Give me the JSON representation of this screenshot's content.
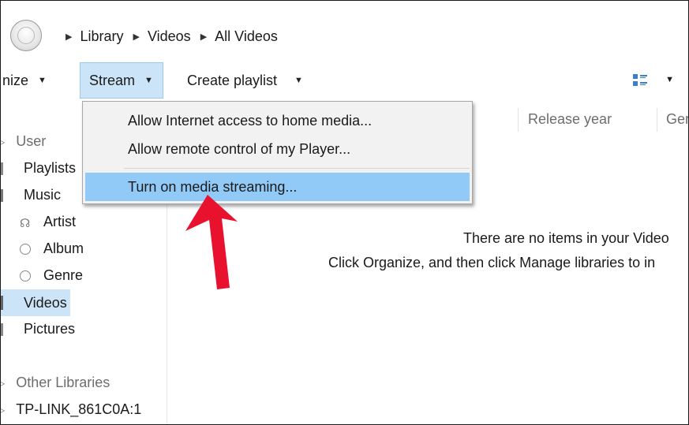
{
  "breadcrumb": [
    "Library",
    "Videos",
    "All Videos"
  ],
  "toolbar": {
    "organize_label": "nize",
    "stream_label": "Stream",
    "create_playlist_label": "Create playlist"
  },
  "stream_menu": {
    "items": [
      "Allow Internet access to home media...",
      "Allow remote control of my Player...",
      "Turn on media streaming..."
    ],
    "highlighted_index": 2
  },
  "sidebar": {
    "user": "User",
    "playlists": "Playlists",
    "music": "Music",
    "artist": "Artist",
    "album": "Album",
    "genre": "Genre",
    "videos": "Videos",
    "pictures": "Pictures",
    "other_libraries": "Other Libraries",
    "device": "TP-LINK_861C0A:1"
  },
  "columns": [
    "Release year",
    "Ger"
  ],
  "content": {
    "empty_line1": "There are no items in your Video",
    "empty_line2": "Click Organize, and then click Manage libraries to in"
  },
  "colors": {
    "selection": "#cce4f7",
    "menu_highlight": "#91c9f7",
    "arrow": "#e8122f"
  },
  "icons": [
    "back-button",
    "breadcrumb-arrow-icon",
    "dropdown-caret-icon",
    "view-options-icon",
    "user-icon",
    "playlists-icon",
    "music-icon",
    "artist-icon",
    "album-icon",
    "genre-icon",
    "videos-icon",
    "pictures-icon"
  ]
}
